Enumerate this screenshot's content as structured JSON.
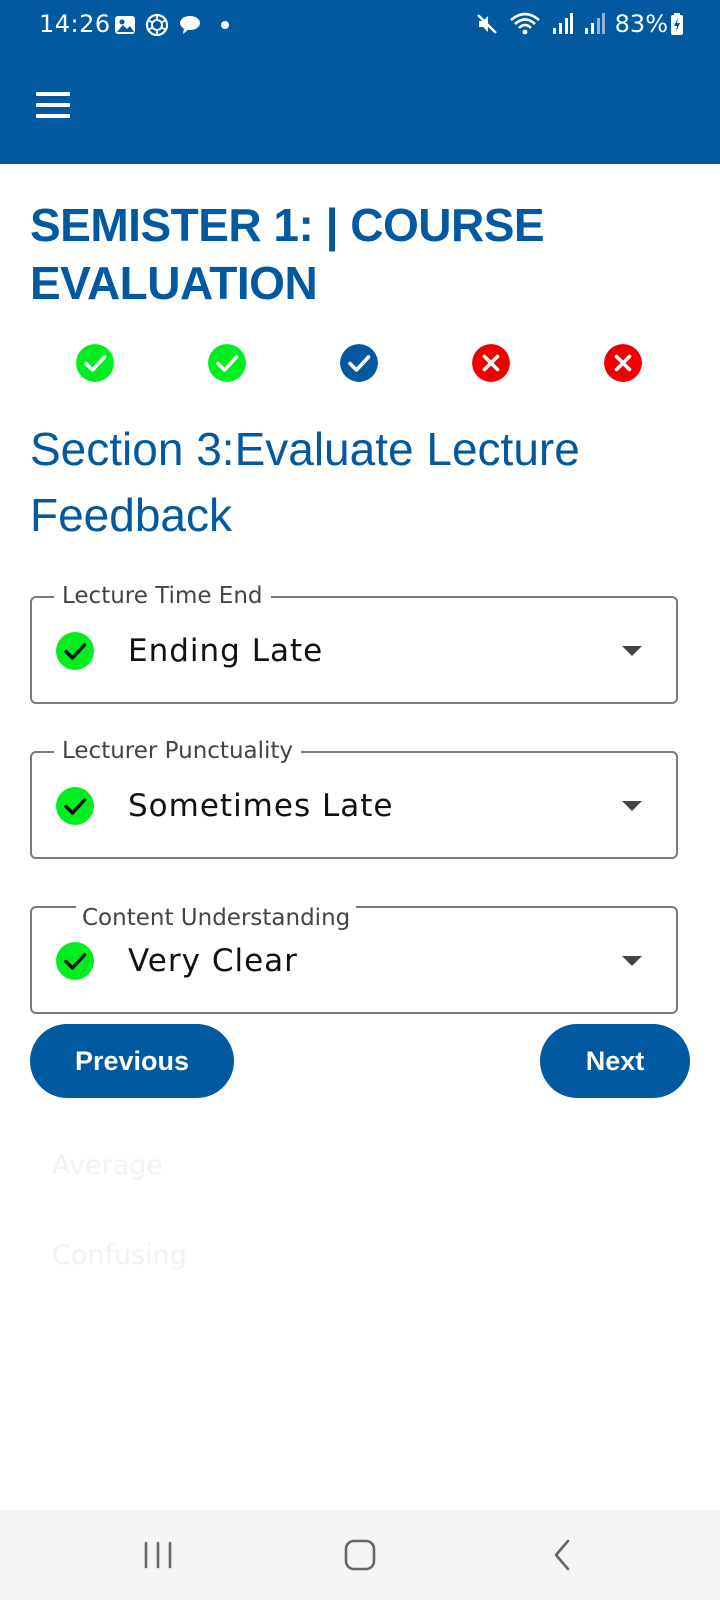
{
  "status_bar": {
    "time": "14:26",
    "battery": "83%",
    "left_icons": [
      "gallery-icon",
      "chatgpt-icon",
      "chat-bubble-icon",
      "dot-icon"
    ],
    "right_icons": [
      "mute-icon",
      "wifi-icon",
      "signal-icon",
      "signal-icon",
      "battery-charging-icon"
    ]
  },
  "app_bar": {
    "menu_icon": "hamburger-menu-icon",
    "background": "#02599f"
  },
  "page": {
    "title": "SEMISTER 1: | COURSE EVALUATION",
    "section_title": "Section 3:Evaluate Lecture Feedback"
  },
  "steps": [
    {
      "status": "complete",
      "icon": "check-circle-icon",
      "color": "#00ee1f"
    },
    {
      "status": "complete",
      "icon": "check-circle-icon",
      "color": "#00ee1f"
    },
    {
      "status": "current",
      "icon": "check-circle-icon",
      "color": "#02599f"
    },
    {
      "status": "incomplete",
      "icon": "x-circle-icon",
      "color": "#ee0000"
    },
    {
      "status": "incomplete",
      "icon": "x-circle-icon",
      "color": "#ee0000"
    }
  ],
  "fields": [
    {
      "label": "Lecture Time End",
      "value": "Ending Late",
      "valid_icon": "check-circle-icon"
    },
    {
      "label": "Lecturer Punctuality",
      "value": "Sometimes Late",
      "valid_icon": "check-circle-icon"
    },
    {
      "label": "Content Understanding",
      "value": "Very Clear",
      "valid_icon": "check-circle-icon"
    }
  ],
  "buttons": {
    "previous": "Previous",
    "next": "Next"
  },
  "faded_options": [
    "Average",
    "Confusing"
  ],
  "nav_bar": {
    "icons": [
      "recents-icon",
      "home-icon",
      "back-icon"
    ]
  },
  "colors": {
    "primary": "#02599f",
    "success": "#00ee1f",
    "error": "#ee0000"
  }
}
